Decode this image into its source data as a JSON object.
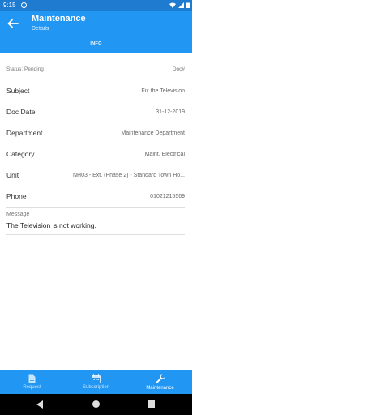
{
  "status_bar": {
    "time": "9:15"
  },
  "app_bar": {
    "title": "Maintenance",
    "subtitle": "Details",
    "tab": "INFO"
  },
  "details": {
    "status": "Status: Pending",
    "doc": "Doc#",
    "rows": [
      {
        "label": "Subject",
        "value": "Fix the Television"
      },
      {
        "label": "Doc Date",
        "value": "31-12-2019"
      },
      {
        "label": "Department",
        "value": "Maintenance Department"
      },
      {
        "label": "Category",
        "value": "Maint. Electrical"
      },
      {
        "label": "Unit",
        "value": "NH03 - Ext. (Phase 2) - Standard Town Ho..."
      },
      {
        "label": "Phone",
        "value": "01021215569"
      }
    ],
    "message_label": "Message",
    "message": "The Television is not working."
  },
  "bottom_nav": {
    "items": [
      {
        "label": "Request",
        "icon": "document-icon"
      },
      {
        "label": "Subscription",
        "icon": "calendar-icon"
      },
      {
        "label": "Maintenance",
        "icon": "wrench-icon"
      }
    ]
  },
  "colors": {
    "primary": "#2196f3",
    "status_bar": "#1e7bd0"
  }
}
